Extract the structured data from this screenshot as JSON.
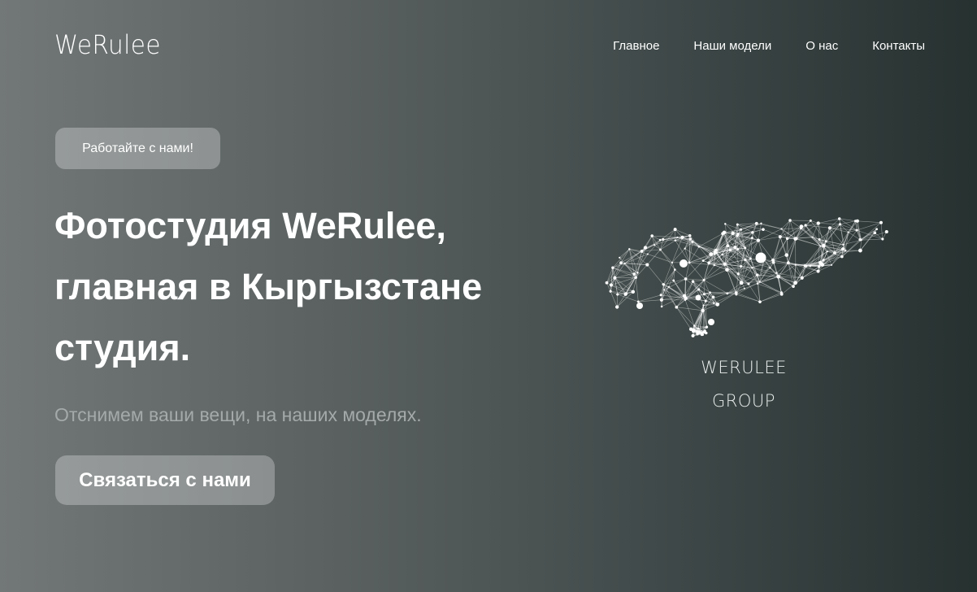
{
  "header": {
    "logo": "WeRulee",
    "nav": [
      {
        "label": "Главное"
      },
      {
        "label": "Наши модели"
      },
      {
        "label": "О нас"
      },
      {
        "label": "Контакты"
      }
    ]
  },
  "hero": {
    "tag_label": "Работайте с нами!",
    "headline_lines": [
      "Фотостудия WeRulee,",
      "главная в Кыргызстане",
      "студия."
    ],
    "subtitle": "Отснимем ваши вещи, на наших моделях.",
    "cta_label": "Связаться с нами"
  },
  "brand_graphic": {
    "line1": "WERULEE",
    "line2": "GROUP"
  },
  "colors": {
    "bg_left": "#727777",
    "bg_right": "#263130",
    "button_bg": "rgba(255,255,255,0.28)",
    "subtitle": "#a4a9a9"
  }
}
